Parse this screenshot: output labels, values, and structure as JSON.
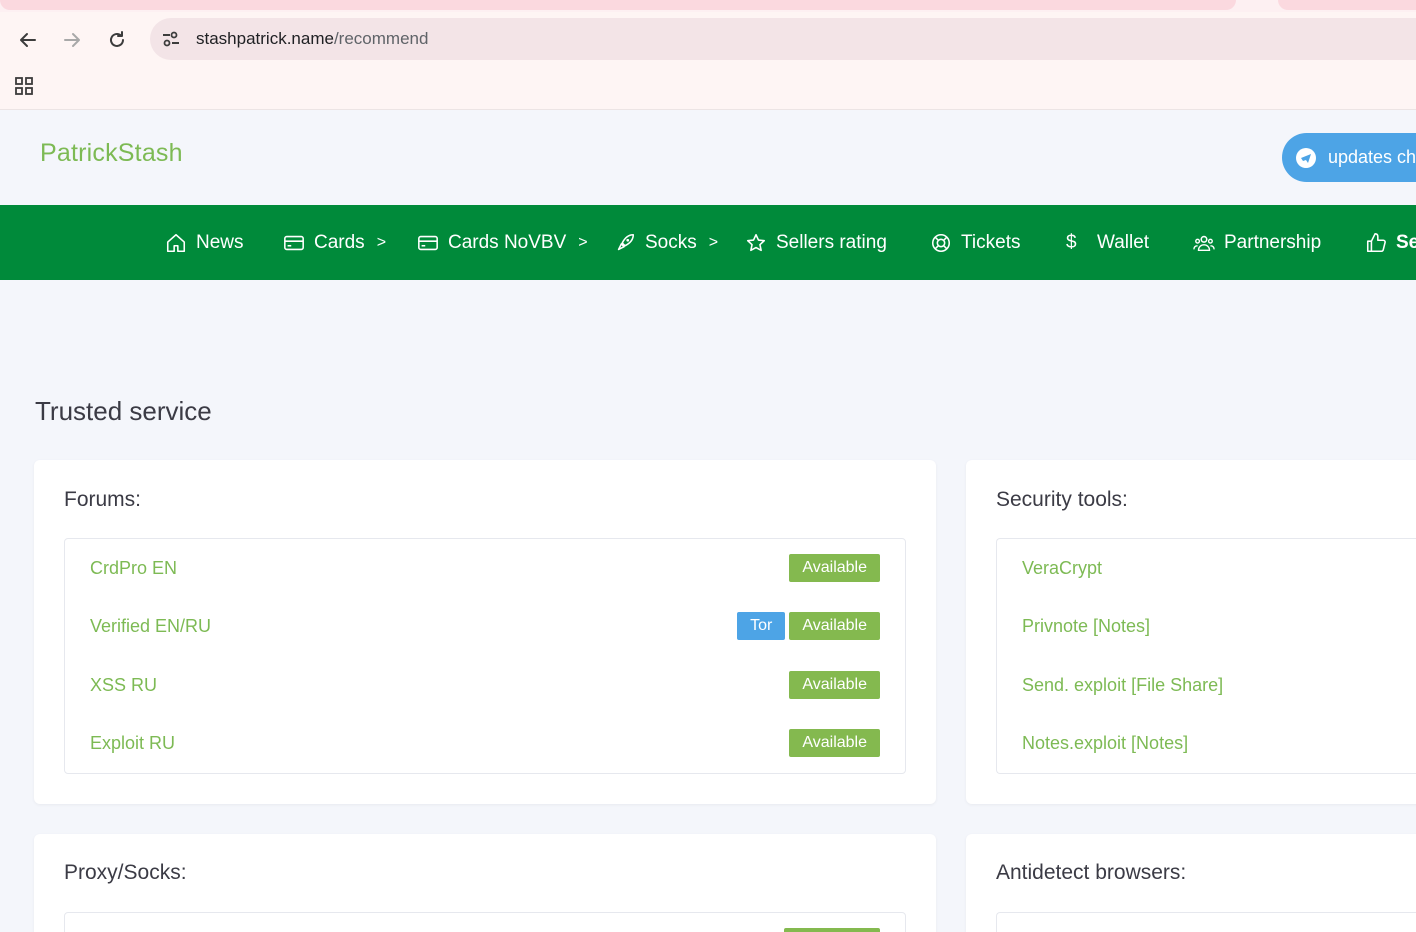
{
  "browser": {
    "url_host": "stashpatrick.name",
    "url_path": "/recommend"
  },
  "header": {
    "logo": "PatrickStash",
    "updates_button": "updates ch"
  },
  "nav": {
    "items": [
      {
        "label": "News",
        "icon": "home-icon"
      },
      {
        "label": "Cards",
        "icon": "credit-card-icon",
        "chevron": ">"
      },
      {
        "label": "Cards NoVBV",
        "icon": "credit-card-icon",
        "chevron": ">"
      },
      {
        "label": "Socks",
        "icon": "rocket-icon",
        "chevron": ">"
      },
      {
        "label": "Sellers rating",
        "icon": "star-icon"
      },
      {
        "label": "Tickets",
        "icon": "lifebuoy-icon"
      },
      {
        "label": "Wallet",
        "icon": "dollar-icon",
        "symbol": "$"
      },
      {
        "label": "Partnership",
        "icon": "users-icon"
      },
      {
        "label": "Se",
        "icon": "thumbs-up-icon"
      }
    ]
  },
  "page": {
    "title": "Trusted service"
  },
  "sections": {
    "forums": {
      "title": "Forums:",
      "items": [
        {
          "name": "CrdPro EN",
          "status": "Available"
        },
        {
          "name": "Verified EN/RU",
          "tag": "Tor",
          "status": "Available"
        },
        {
          "name": "XSS RU",
          "status": "Available"
        },
        {
          "name": "Exploit RU",
          "status": "Available"
        }
      ]
    },
    "security": {
      "title": "Security tools:",
      "items": [
        {
          "name": "VeraCrypt"
        },
        {
          "name": "Privnote [Notes]"
        },
        {
          "name": "Send. exploit [File Share]"
        },
        {
          "name": "Notes.exploit [Notes]"
        }
      ]
    },
    "proxy": {
      "title": "Proxy/Socks:"
    },
    "antidetect": {
      "title": "Antidetect browsers:"
    }
  },
  "colors": {
    "accent_green": "#7dba54",
    "nav_green": "#008a3a",
    "badge_available": "#84b94f",
    "badge_tor": "#4da4e6"
  }
}
